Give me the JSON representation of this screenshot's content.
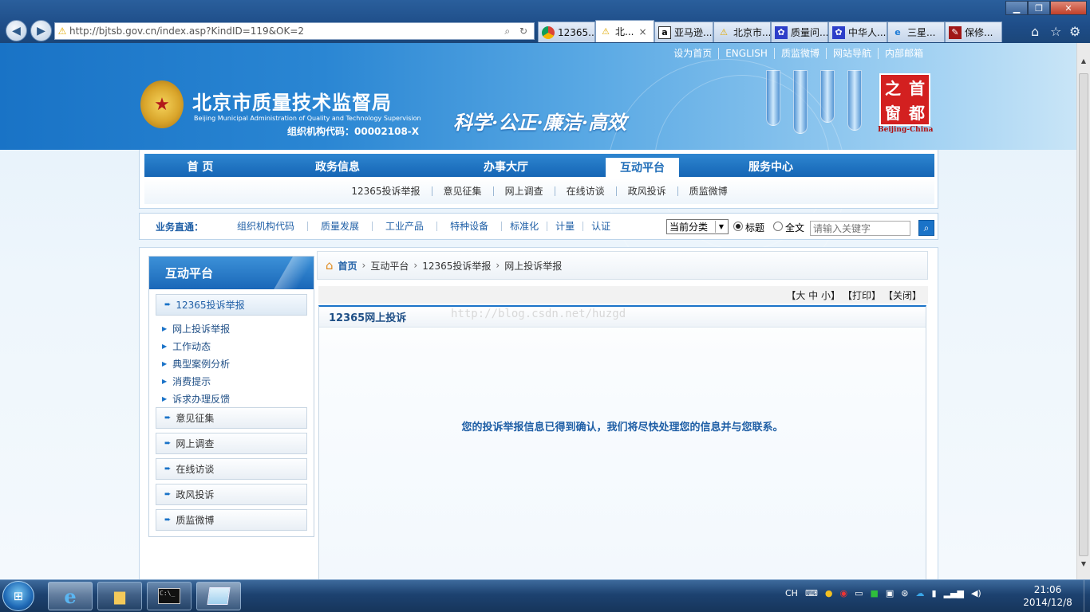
{
  "browser": {
    "address": "http://bjtsb.gov.cn/index.asp?KindID=119&OK=2",
    "address_actions": "⌕ ↻",
    "tabs": [
      {
        "label": "12365...",
        "icon": "google-chrome-icon"
      },
      {
        "label": "北...",
        "icon": "warning-icon",
        "active": true,
        "close": "×"
      },
      {
        "label": "亚马逊...",
        "icon": "amazon-icon"
      },
      {
        "label": "北京市...",
        "icon": "warning-icon"
      },
      {
        "label": "质量问...",
        "icon": "baidu-paw-icon"
      },
      {
        "label": "中华人...",
        "icon": "baidu-paw-icon"
      },
      {
        "label": "三星...",
        "icon": "ie-icon"
      },
      {
        "label": "保修...",
        "icon": "page-icon"
      }
    ]
  },
  "site": {
    "top_links": [
      "设为首页",
      "ENGLISH",
      "质监微博",
      "网站导航",
      "内部邮箱"
    ],
    "title": "北京市质量技术监督局",
    "subtitle_en": "Beijing Municipal Administration of Quality and Technology Supervision",
    "org_code": "组织机构代码：00002108-X",
    "slogan": "科学·公正·廉洁·高效",
    "capital_logo": [
      "之",
      "首",
      "窗",
      "都"
    ],
    "capital_logo_en": "Beijing-China",
    "main_nav": [
      "首 页",
      "政务信息",
      "办事大厅",
      "互动平台",
      "服务中心"
    ],
    "sub_nav": [
      "12365投诉举报",
      "意见征集",
      "网上调查",
      "在线访谈",
      "政风投诉",
      "质监微博"
    ],
    "biz": {
      "label": "业务直通：",
      "links": [
        "组织机构代码",
        "质量发展",
        "工业产品",
        "特种设备",
        "标准化",
        "计量",
        "认证"
      ],
      "select_value": "当前分类",
      "radio_title": "标题",
      "radio_full": "全文",
      "search_placeholder": "请输入关键字"
    },
    "sidebar": {
      "title": "互动平台",
      "active": "12365投诉举报",
      "subitems": [
        "网上投诉举报",
        "工作动态",
        "典型案例分析",
        "消费提示",
        "诉求办理反馈"
      ],
      "items": [
        "意见征集",
        "网上调查",
        "在线访谈",
        "政风投诉",
        "质监微博"
      ]
    },
    "breadcrumb": [
      "首页",
      "互动平台",
      "12365投诉举报",
      "网上投诉举报"
    ],
    "font_tools": {
      "size": "【大 中 小】",
      "print": "【打印】",
      "close": "【关闭】"
    },
    "watermark": "http://blog.csdn.net/huzgd",
    "article_title": "12365网上投诉",
    "message": "您的投诉举报信息已得到确认，我们将尽快处理您的信息并与您联系。"
  },
  "taskbar": {
    "tray_lang": "CH",
    "time": "21:06",
    "date": "2014/12/8"
  },
  "colors": {
    "brand_blue": "#1a73c8",
    "nav_blue": "#1565b5",
    "link_blue": "#1f5fa6",
    "logo_red": "#d32020"
  }
}
